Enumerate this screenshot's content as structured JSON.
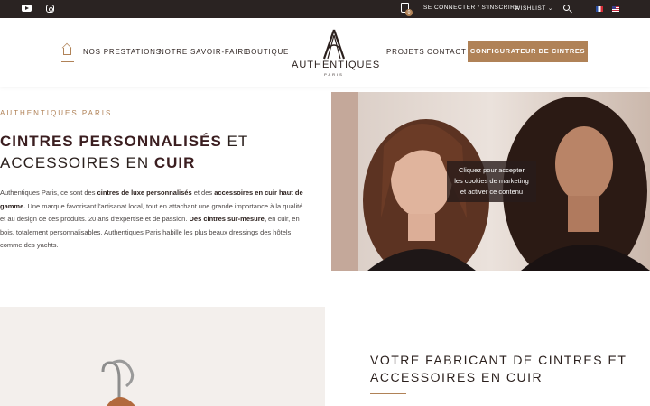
{
  "topbar": {
    "social": [
      "youtube-icon",
      "instagram-icon"
    ],
    "cart_count": "0",
    "login": "SE CONNECTER / S'INSCRIRE",
    "wishlist": "WISHLIST ⌄",
    "languages": [
      "fr",
      "en"
    ]
  },
  "nav": {
    "items": [
      "NOS PRESTATIONS",
      "NOTRE SAVOIR-FAIRE",
      "BOUTIQUE",
      "PROJETS",
      "CONTACT"
    ],
    "cta": "CONFIGURATEUR DE CINTRES"
  },
  "logo": {
    "name": "AUTHENTIQUES",
    "sub": "PARIS"
  },
  "hero": {
    "eyebrow": "AUTHENTIQUES PARIS",
    "title_bold_1": "CINTRES PERSONNALISÉS",
    "title_light_1": " ET",
    "title_light_2": "ACCESSOIRES EN ",
    "title_bold_2": "CUIR",
    "intro": {
      "p1": "Authentiques Paris, ce sont des ",
      "b1": "cintres de luxe personnalisés",
      "p2": " et des ",
      "b2": "accessoires en cuir haut de gamme.",
      "p3": " Une marque favorisant l'artisanat local, tout en attachant une grande importance à la qualité et au design de ces produits. 20 ans d'expertise et de passion. ",
      "b3": "Des cintres sur-mesure,",
      "p4": " en cuir, en bois, totalement personnalisables. Authentiques Paris habille les plus beaux dressings des hôtels comme des yachts."
    },
    "cookie_notice": [
      "Cliquez pour accepter",
      "les cookies de marketing",
      "et activer ce contenu"
    ]
  },
  "section2": {
    "title_line1": "VOTRE FABRICANT DE CINTRES ET",
    "title_line2": "ACCESSOIRES EN CUIR"
  },
  "colors": {
    "accent": "#b08257",
    "dark": "#2a2322",
    "heading": "#3b1e20"
  }
}
